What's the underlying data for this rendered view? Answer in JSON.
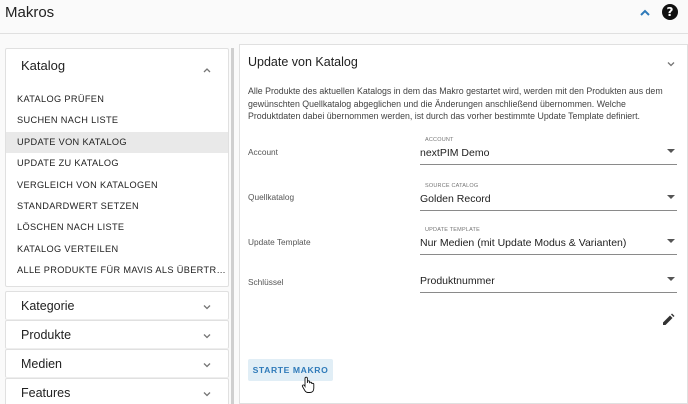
{
  "page": {
    "title": "Makros",
    "help_icon": "?"
  },
  "sidebar": {
    "katalog": {
      "label": "Katalog",
      "items": [
        "KATALOG PRÜFEN",
        "SUCHEN NACH LISTE",
        "UPDATE VON KATALOG",
        "UPDATE ZU KATALOG",
        "VERGLEICH VON KATALOGEN",
        "STANDARDWERT SETZEN",
        "LÖSCHEN NACH LISTE",
        "KATALOG VERTEILEN",
        "ALLE PRODUKTE FÜR MAVIS ALS ÜBERTRAGEN..."
      ],
      "active_index": 2
    },
    "sections": [
      "Kategorie",
      "Produkte",
      "Medien",
      "Features"
    ]
  },
  "main": {
    "title": "Update von Katalog",
    "description": "Alle Produkte des aktuellen Katalogs in dem das Makro gestartet wird, werden mit den Produkten aus dem gewünschten Quellkatalog abgeglichen und die Änderungen anschließend übernommen. Welche Produktdaten dabei übernommen werden, ist durch das vorher bestimmte Update Template definiert.",
    "fields": [
      {
        "label": "Account",
        "small": "ACCOUNT",
        "value": "nextPIM Demo"
      },
      {
        "label": "Quellkatalog",
        "small": "SOURCE CATALOG",
        "value": "Golden Record"
      },
      {
        "label": "Update Template",
        "small": "UPDATE TEMPLATE",
        "value": "Nur Medien (mit Update Modus & Varianten)"
      },
      {
        "label": "Schlüssel",
        "small": "",
        "value": "Produktnummer"
      }
    ],
    "start_button": "STARTE MAKRO"
  },
  "colors": {
    "accent": "#2f7ab9",
    "button_bg": "#e1eef6",
    "active_item_bg": "#e9e9e9"
  }
}
